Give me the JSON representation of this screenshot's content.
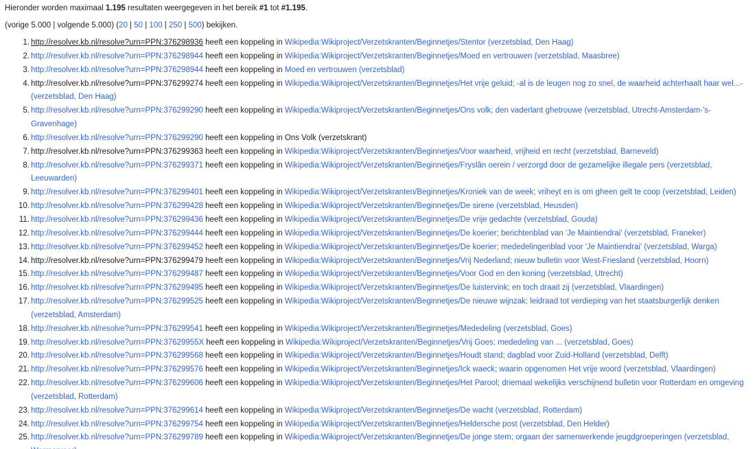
{
  "intro": {
    "prefix": "Hieronder worden maximaal ",
    "max_count": "1.195",
    "middle": " resultaten weergegeven in het bereik ",
    "range_start": "#1",
    "range_to": " tot ",
    "range_end": "#1.195",
    "suffix": "."
  },
  "pager": {
    "open": "(",
    "prev": "vorige 5.000",
    "sep1": " | ",
    "next": "volgende 5.000",
    "close_mid": ") (",
    "limits": [
      "20",
      "50",
      "100",
      "250",
      "500"
    ],
    "pipe": " | ",
    "end": ") bekijken."
  },
  "link_word": " heeft een koppeling in ",
  "results": [
    {
      "num": "1.",
      "url": "http://resolver.kb.nl/resolve?urn=PPN:376298936",
      "target": "Wikipedia:Wikiproject/Verzetskranten/Beginnetjes/Stentor (verzetsblad, Den Haag)"
    },
    {
      "num": "2.",
      "url": "http://resolver.kb.nl/resolve?urn=PPN:376298944",
      "target": "Wikipedia:Wikiproject/Verzetskranten/Beginnetjes/Moed en vertrouwen (verzetsblad, Maasbree)"
    },
    {
      "num": "3.",
      "url": "http://resolver.kb.nl/resolve?urn=PPN:376298944",
      "target": "Moed en vertrouwen (verzetsblad)"
    },
    {
      "num": "4.",
      "url": "http://resolver.kb.nl/resolve?urn=PPN:376299274",
      "target": "Wikipedia:Wikiproject/Verzetskranten/Beginnetjes/Het vrije geluid; -al is de leugen nog zo snel, de waarheid achterhaalt haar wel...- (verzetsblad, Den Haag)"
    },
    {
      "num": "5.",
      "url": "http://resolver.kb.nl/resolve?urn=PPN:376299290",
      "target": "Wikipedia:Wikiproject/Verzetskranten/Beginnetjes/Ons volk; den vaderlant ghetrouwe (verzetsblad, Utrecht-Amsterdam-'s-Gravenhage)"
    },
    {
      "num": "6.",
      "url": "http://resolver.kb.nl/resolve?urn=PPN:376299290",
      "target": "Ons Volk (verzetskrant)"
    },
    {
      "num": "7.",
      "url": "http://resolver.kb.nl/resolve?urn=PPN:376299363",
      "target": "Wikipedia:Wikiproject/Verzetskranten/Beginnetjes/Voor waarheid, vrijheid en recht (verzetsblad, Barneveld)"
    },
    {
      "num": "8.",
      "url": "http://resolver.kb.nl/resolve?urn=PPN:376299371",
      "target": "Wikipedia:Wikiproject/Verzetskranten/Beginnetjes/Fryslân oerein / verzorgd door de gezamelijke illegale pers (verzetsblad, Leeuwarden)"
    },
    {
      "num": "9.",
      "url": "http://resolver.kb.nl/resolve?urn=PPN:376299401",
      "target": "Wikipedia:Wikiproject/Verzetskranten/Beginnetjes/Kroniek van de week; vriheyt en is om gheen gelt te coop (verzetsblad, Leiden)"
    },
    {
      "num": "10.",
      "url": "http://resolver.kb.nl/resolve?urn=PPN:376299428",
      "target": "Wikipedia:Wikiproject/Verzetskranten/Beginnetjes/De sirene (verzetsblad, Heusden)"
    },
    {
      "num": "11.",
      "url": "http://resolver.kb.nl/resolve?urn=PPN:376299436",
      "target": "Wikipedia:Wikiproject/Verzetskranten/Beginnetjes/De vrije gedachte (verzetsblad, Gouda)"
    },
    {
      "num": "12.",
      "url": "http://resolver.kb.nl/resolve?urn=PPN:376299444",
      "target": "Wikipedia:Wikiproject/Verzetskranten/Beginnetjes/De koerier; berichtenblad van 'Je Maintiendrai' (verzetsblad, Franeker)"
    },
    {
      "num": "13.",
      "url": "http://resolver.kb.nl/resolve?urn=PPN:376299452",
      "target": "Wikipedia:Wikiproject/Verzetskranten/Beginnetjes/De koerier; mededelingenblad voor 'Je Maintiendrai' (verzetsblad, Warga)"
    },
    {
      "num": "14.",
      "url": "http://resolver.kb.nl/resolve?urn=PPN:376299479",
      "target": "Wikipedia:Wikiproject/Verzetskranten/Beginnetjes/Vrij Nederland; nieuw bulletin voor West-Friesland (verzetsblad, Hoorn)"
    },
    {
      "num": "15.",
      "url": "http://resolver.kb.nl/resolve?urn=PPN:376299487",
      "target": "Wikipedia:Wikiproject/Verzetskranten/Beginnetjes/Voor God en den koning (verzetsblad, Utrecht)"
    },
    {
      "num": "16.",
      "url": "http://resolver.kb.nl/resolve?urn=PPN:376299495",
      "target": "Wikipedia:Wikiproject/Verzetskranten/Beginnetjes/De luistervink; en toch draait zij (verzetsblad, Vlaardingen)"
    },
    {
      "num": "17.",
      "url": "http://resolver.kb.nl/resolve?urn=PPN:376299525",
      "target": "Wikipedia:Wikiproject/Verzetskranten/Beginnetjes/De nieuwe wijnzak; leidraad tot verdieping van het staatsburgerlijk denken (verzetsblad, Amsterdam)"
    },
    {
      "num": "18.",
      "url": "http://resolver.kb.nl/resolve?urn=PPN:376299541",
      "target": "Wikipedia:Wikiproject/Verzetskranten/Beginnetjes/Mededeling (verzetsblad, Goes)"
    },
    {
      "num": "19.",
      "url": "http://resolver.kb.nl/resolve?urn=PPN:37629955X",
      "target": "Wikipedia:Wikiproject/Verzetskranten/Beginnetjes/Vrij Goes; mededeling van ... (verzetsblad, Goes)"
    },
    {
      "num": "20.",
      "url": "http://resolver.kb.nl/resolve?urn=PPN:376299568",
      "target": "Wikipedia:Wikiproject/Verzetskranten/Beginnetjes/Houdt stand; dagblad voor Zuid-Holland (verzetsblad, Delft)"
    },
    {
      "num": "21.",
      "url": "http://resolver.kb.nl/resolve?urn=PPN:376299576",
      "target": "Wikipedia:Wikiproject/Verzetskranten/Beginnetjes/Ick waeck; waarin opgenomen Het vrije woord (verzetsblad, Vlaardingen)"
    },
    {
      "num": "22.",
      "url": "http://resolver.kb.nl/resolve?urn=PPN:376299606",
      "target": "Wikipedia:Wikiproject/Verzetskranten/Beginnetjes/Het Parool; driemaal wekelijks verschijnend bulletin voor Rotterdam en omgeving (verzetsblad, Rotterdam)"
    },
    {
      "num": "23.",
      "url": "http://resolver.kb.nl/resolve?urn=PPN:376299614",
      "target": "Wikipedia:Wikiproject/Verzetskranten/Beginnetjes/De wacht (verzetsblad, Rotterdam)"
    },
    {
      "num": "24.",
      "url": "http://resolver.kb.nl/resolve?urn=PPN:376299754",
      "target": "Wikipedia:Wikiproject/Verzetskranten/Beginnetjes/Heldersche post (verzetsblad, Den Helder)"
    },
    {
      "num": "25.",
      "url": "http://resolver.kb.nl/resolve?urn=PPN:376299789",
      "target": "Wikipedia:Wikiproject/Verzetskranten/Beginnetjes/De jonge stem; orgaan der samenwerkende jeugdgroeperingen (verzetsblad, Wormerveer)"
    }
  ],
  "visited_urls": [
    1,
    4,
    7,
    14
  ],
  "underlined_urls": [
    1
  ],
  "visited_targets": [
    6
  ],
  "colors": {
    "link": "#3366cc",
    "visited_link": "#202122",
    "text": "#202122"
  }
}
